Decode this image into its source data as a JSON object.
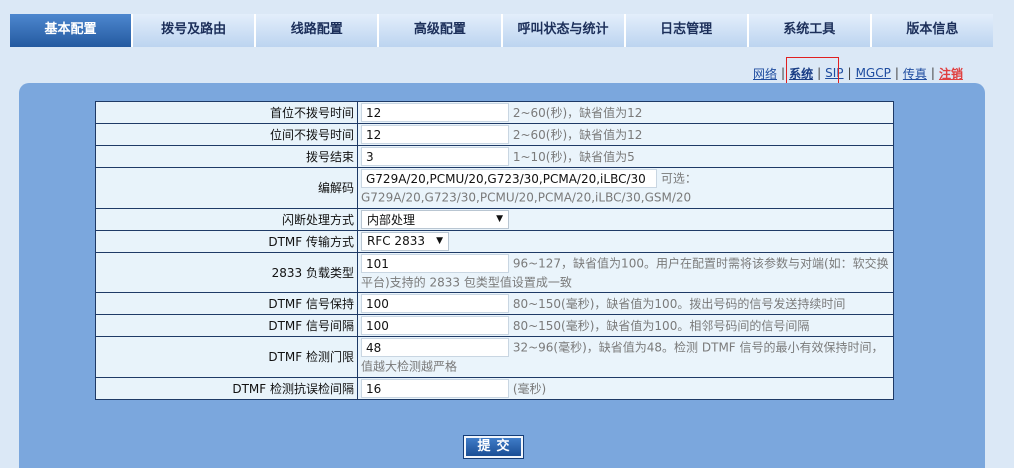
{
  "nav": {
    "tabs": [
      "基本配置",
      "拨号及路由",
      "线路配置",
      "高级配置",
      "呼叫状态与统计",
      "日志管理",
      "系统工具",
      "版本信息"
    ],
    "active_index": 0
  },
  "subnav": {
    "network": "网络",
    "system": "系统",
    "sip": "SIP",
    "mgcp": "MGCP",
    "fax": "传真",
    "logout": "注销",
    "separator": "|"
  },
  "form": {
    "rows": [
      {
        "label": "首位不拨号时间",
        "value": "12",
        "hint": "2~60(秒)，缺省值为12"
      },
      {
        "label": "位间不拨号时间",
        "value": "12",
        "hint": "2~60(秒)，缺省值为12"
      },
      {
        "label": "拨号结束",
        "value": "3",
        "hint": "1~10(秒)，缺省值为5"
      },
      {
        "label": "编解码",
        "value": "G729A/20,PCMU/20,G723/30,PCMA/20,iLBC/30",
        "hint_prefix": "可选：",
        "hint": "G729A/20,G723/30,PCMU/20,PCMA/20,iLBC/30,GSM/20"
      },
      {
        "label": "闪断处理方式",
        "selected": "内部处理"
      },
      {
        "label": "DTMF 传输方式",
        "selected": "RFC 2833"
      },
      {
        "label": "2833 负载类型",
        "value": "101",
        "hint": "96~127，缺省值为100。用户在配置时需将该参数与对端(如：软交换",
        "hint2": "平台)支持的 2833 包类型值设置成一致"
      },
      {
        "label": "DTMF 信号保持",
        "value": "100",
        "hint": "80~150(毫秒)，缺省值为100。拨出号码的信号发送持续时间"
      },
      {
        "label": "DTMF 信号间隔",
        "value": "100",
        "hint": "80~150(毫秒)，缺省值为100。相邻号码间的信号间隔"
      },
      {
        "label": "DTMF 检测门限",
        "value": "48",
        "hint": "32~96(毫秒)，缺省值为48。检测 DTMF 信号的最小有效保持时间，",
        "hint2": "值越大检测越严格"
      },
      {
        "label": "DTMF 检测抗误检间隔",
        "value": "16",
        "hint": "(毫秒)"
      }
    ]
  },
  "submit_label": "提交"
}
